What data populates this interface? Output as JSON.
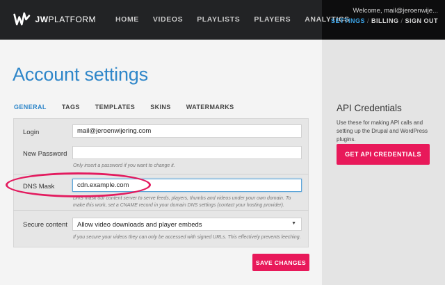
{
  "brand": {
    "logo_text_bold": "JW",
    "logo_text": "PLATFORM"
  },
  "nav": {
    "items": [
      "HOME",
      "VIDEOS",
      "PLAYLISTS",
      "PLAYERS",
      "ANALYTICS"
    ]
  },
  "account": {
    "welcome": "Welcome, mail@jeroenwije...",
    "links": [
      "SETTINGS",
      "BILLING",
      "SIGN OUT"
    ],
    "separator": "/"
  },
  "page": {
    "title": "Account settings"
  },
  "tabs": [
    "GENERAL",
    "TAGS",
    "TEMPLATES",
    "SKINS",
    "WATERMARKS"
  ],
  "form": {
    "login": {
      "label": "Login",
      "value": "mail@jeroenwijering.com"
    },
    "password": {
      "label": "New Password",
      "value": "",
      "hint": "Only insert a password if you want to change it."
    },
    "dns": {
      "label": "DNS Mask",
      "value": "cdn.example.com",
      "hint": "DNS mask our content server to serve feeds, players, thumbs and videos under your own domain. To make this work, set a CNAME record in your domain DNS settings (contact your hosting provider)."
    },
    "secure": {
      "label": "Secure content",
      "value": "Allow video downloads and player embeds",
      "hint": "If you secure your videos they can only be accessed with signed URLs. This effectively prevents leeching."
    },
    "save_label": "SAVE CHANGES"
  },
  "sidebar": {
    "title": "API Credentials",
    "description": "Use these for making API calls and setting up the Drupal and WordPress plugins.",
    "button": "GET API CREDENTIALS"
  },
  "colors": {
    "accent": "#e8195a",
    "link_blue": "#2e86c9",
    "active_blue": "#3ba3e6",
    "topbar": "#222325"
  }
}
